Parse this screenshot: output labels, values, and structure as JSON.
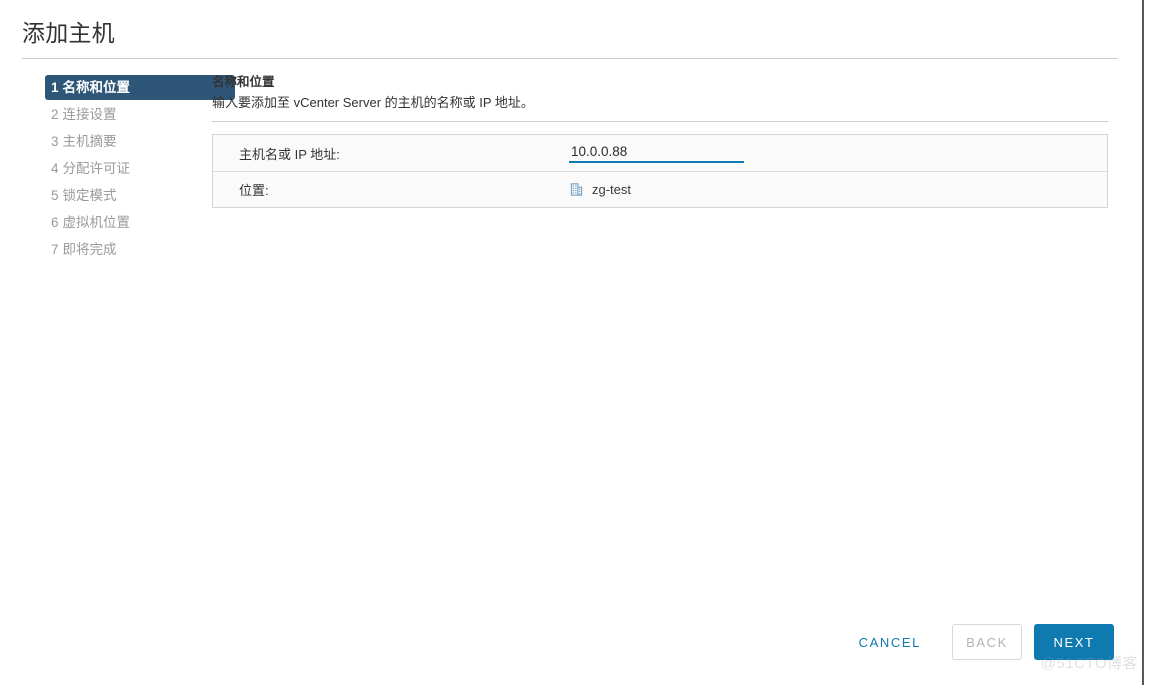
{
  "window": {
    "title": "添加主机"
  },
  "stepper": {
    "steps": [
      {
        "num": "1",
        "label": "名称和位置",
        "active": true
      },
      {
        "num": "2",
        "label": "连接设置",
        "active": false
      },
      {
        "num": "3",
        "label": "主机摘要",
        "active": false
      },
      {
        "num": "4",
        "label": "分配许可证",
        "active": false
      },
      {
        "num": "5",
        "label": "锁定模式",
        "active": false
      },
      {
        "num": "6",
        "label": "虚拟机位置",
        "active": false
      },
      {
        "num": "7",
        "label": "即将完成",
        "active": false
      }
    ]
  },
  "content": {
    "heading": "名称和位置",
    "description": "输入要添加至 vCenter Server 的主机的名称或 IP 地址。",
    "fields": [
      {
        "label": "主机名或 IP 地址:",
        "type": "text",
        "value": "10.0.0.88",
        "placeholder": ""
      },
      {
        "label": "位置:",
        "type": "location",
        "icon": "datacenter-icon",
        "value": "zg-test"
      }
    ]
  },
  "footer": {
    "cancel_label": "CANCEL",
    "back_label": "BACK",
    "back_disabled": true,
    "next_label": "NEXT"
  },
  "watermark": {
    "text": "@51CTO博客"
  },
  "colors": {
    "accent_blue": "#0f7ab0",
    "step_active_bg": "#2d5678",
    "panel_bg": "#fafafa",
    "panel_border": "#d4d4d4",
    "muted_text": "#9a9a9a"
  }
}
